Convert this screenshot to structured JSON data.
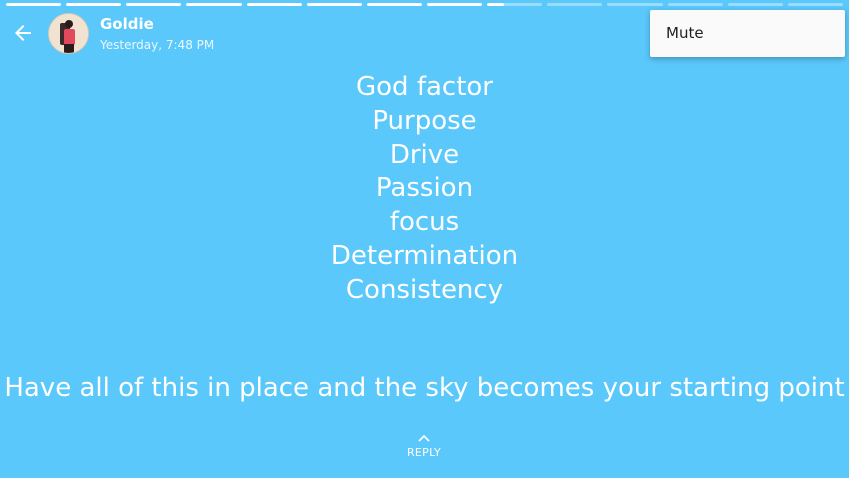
{
  "header": {
    "user_name": "Goldie",
    "timestamp": "Yesterday, 7:48 PM"
  },
  "progress": {
    "segments_total": 14,
    "segments_viewed": 8,
    "current_segment_fill": 0.3
  },
  "menu": {
    "items": [
      {
        "label": "Mute"
      }
    ]
  },
  "story": {
    "lines": [
      "God factor",
      "Purpose",
      " Drive",
      "Passion",
      " focus",
      "Determination",
      "Consistency"
    ],
    "caption": "Have all of this in place and the sky becomes your starting point"
  },
  "reply": {
    "label": "REPLY"
  },
  "colors": {
    "background": "#5ac8fb",
    "menu_background": "#fafafa",
    "text": "#ffffff"
  },
  "icons": {
    "back": "arrow-left-icon",
    "reply": "chevron-up-icon"
  }
}
